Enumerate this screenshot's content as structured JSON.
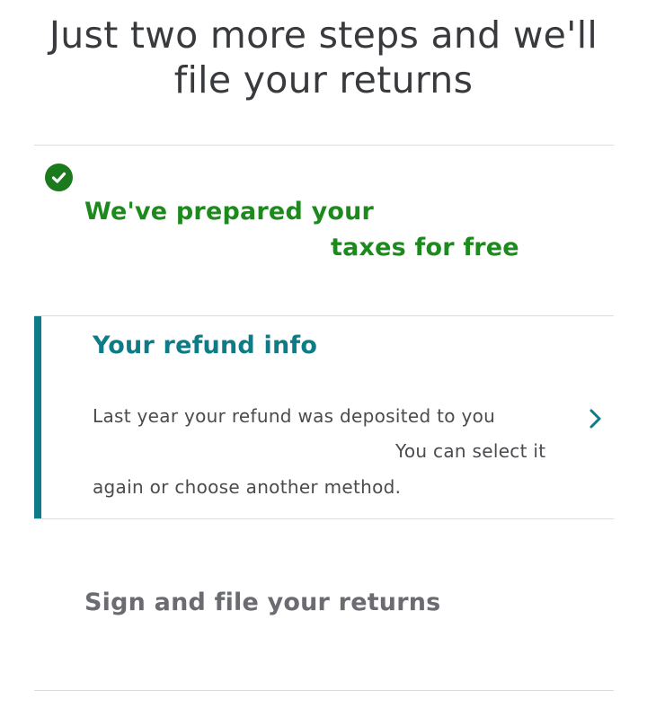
{
  "header": {
    "title_line1": "Just two more steps and we'll",
    "title_line2": "file your returns"
  },
  "steps": {
    "prepared": {
      "status": "complete",
      "label_line1": "We've prepared your",
      "label_line2": "taxes for free",
      "color": "#1d8a1d",
      "icon": "checkmark-circle-icon"
    },
    "refund": {
      "title": "Your refund info",
      "desc_line1": "Last year your refund was deposited to you",
      "desc_line2": "You can select it",
      "desc_line3": "again or choose another method.",
      "accent": "#0e7c86",
      "icon": "chevron-right-icon"
    },
    "sign": {
      "label": "Sign and file your returns"
    }
  }
}
